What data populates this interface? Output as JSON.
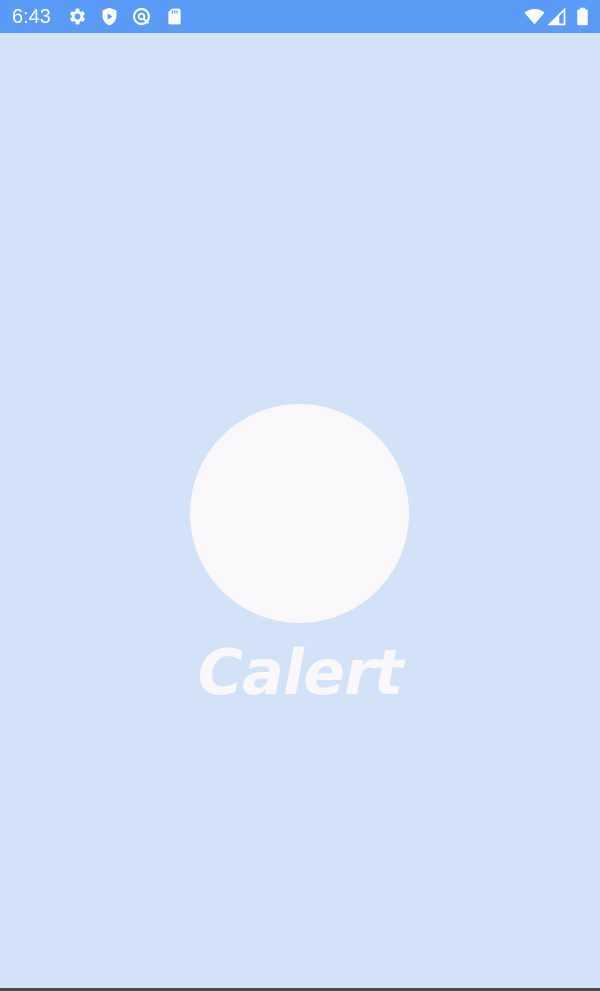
{
  "status_bar": {
    "time": "6:43",
    "icons_left": [
      "settings-gear-icon",
      "shield-play-icon",
      "at-sign-icon",
      "sd-card-icon"
    ],
    "icons_right": [
      "wifi-icon",
      "cellular-signal-icon",
      "battery-icon"
    ],
    "color": "#5b9bf8"
  },
  "splash": {
    "app_name": "Calert",
    "background_color": "#d2e2f8",
    "logo_color": "#faf8fb"
  }
}
